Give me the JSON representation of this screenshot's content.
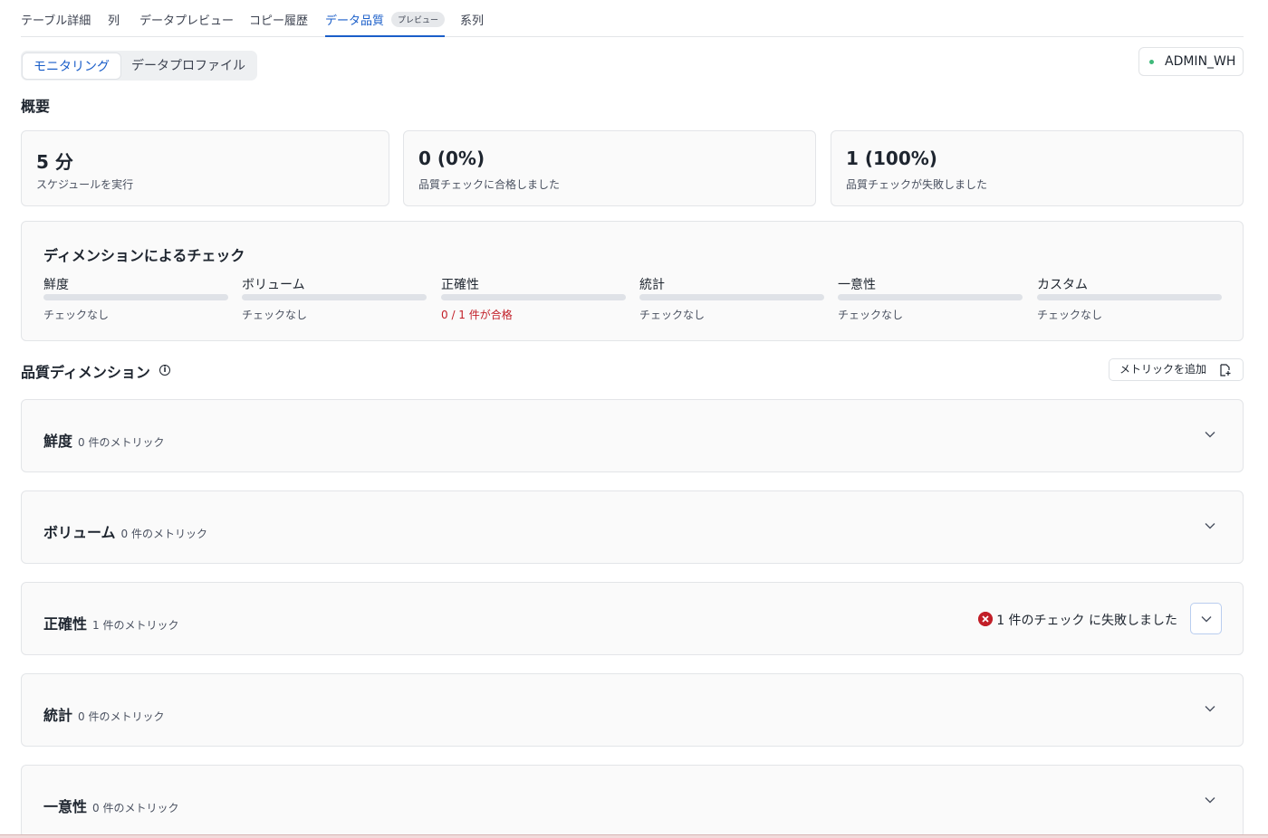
{
  "tabs": [
    {
      "label": "テーブル詳細"
    },
    {
      "label": "列"
    },
    {
      "label": "データプレビュー"
    },
    {
      "label": "コピー履歴"
    },
    {
      "label": "データ品質",
      "badge": "プレビュー"
    },
    {
      "label": "系列"
    }
  ],
  "segmented": {
    "monitoring": "モニタリング",
    "profile": "データプロファイル"
  },
  "warehouse": {
    "name": "ADMIN_WH",
    "status_color": "#3fb97a"
  },
  "overview": {
    "title": "概要",
    "cards": [
      {
        "value": "5 分",
        "label": "スケジュールを実行"
      },
      {
        "value": "0 (0%)",
        "label": "品質チェックに合格しました"
      },
      {
        "value": "1 (100%)",
        "label": "品質チェックが失敗しました"
      }
    ]
  },
  "dimension_checks": {
    "title": "ディメンションによるチェック",
    "items": [
      {
        "name": "鮮度",
        "status": "チェックなし"
      },
      {
        "name": "ボリューム",
        "status": "チェックなし"
      },
      {
        "name": "正確性",
        "status": "0 / 1 件が合格"
      },
      {
        "name": "統計",
        "status": "チェックなし"
      },
      {
        "name": "一意性",
        "status": "チェックなし"
      },
      {
        "name": "カスタム",
        "status": "チェックなし"
      }
    ]
  },
  "quality_dimensions": {
    "title": "品質ディメンション",
    "add_metric": "メトリックを追加",
    "sections": [
      {
        "name": "鮮度",
        "count": "0 件のメトリック"
      },
      {
        "name": "ボリューム",
        "count": "0 件のメトリック"
      },
      {
        "name": "正確性",
        "count": "1 件のメトリック",
        "failure": "1 件のチェック に失敗しました"
      },
      {
        "name": "統計",
        "count": "0 件のメトリック"
      },
      {
        "name": "一意性",
        "count": "0 件のメトリック"
      }
    ]
  },
  "colors": {
    "accent": "#1a5ec9",
    "fail": "#c21f28"
  }
}
